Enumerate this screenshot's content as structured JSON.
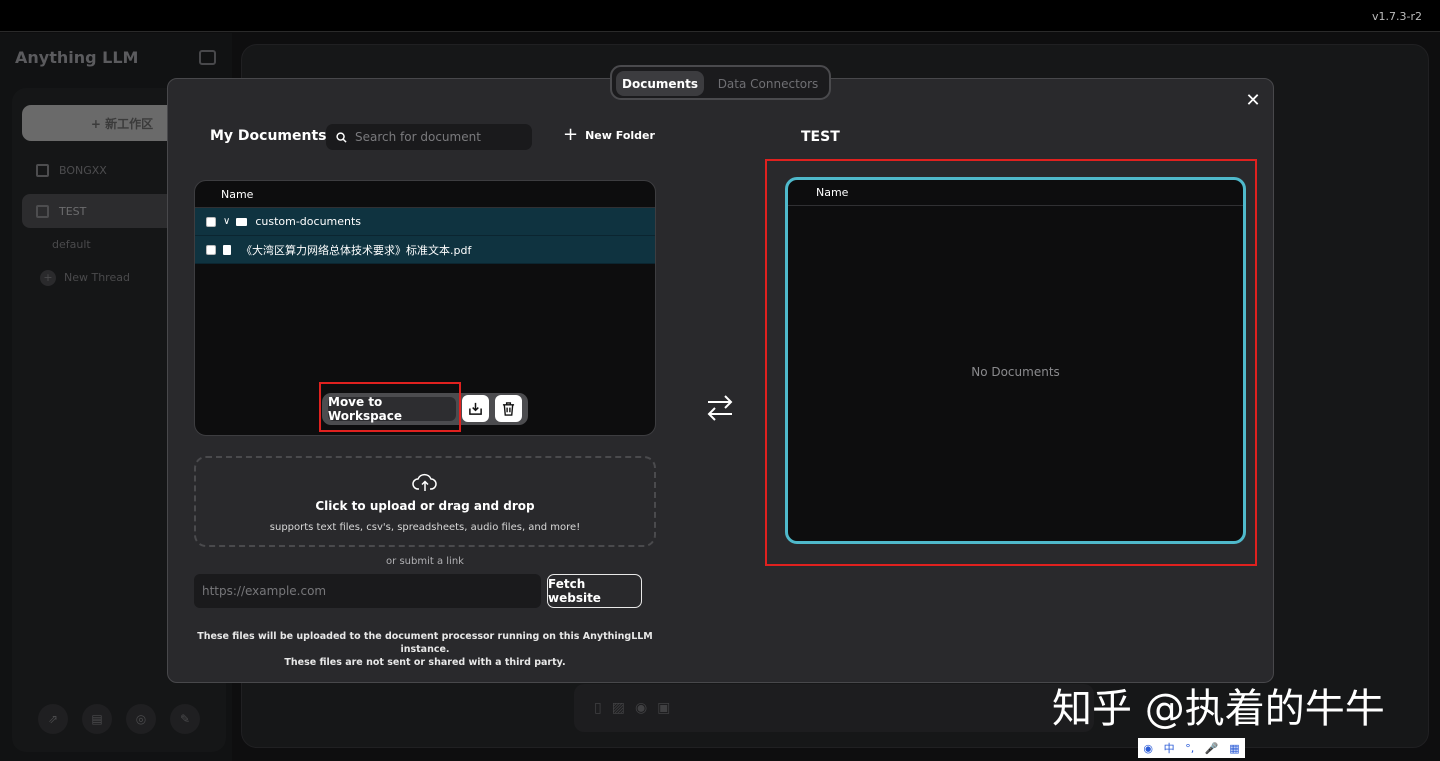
{
  "version": "v1.7.3-r2",
  "sidebar": {
    "logo": "Anything LLM",
    "new_workspace_label": "+ 新工作区",
    "workspaces": [
      {
        "label": "BONGXX"
      },
      {
        "label": "TEST"
      }
    ],
    "threads": [
      {
        "label": "default"
      },
      {
        "label": "New Thread"
      }
    ],
    "footer_icons": [
      "github-icon",
      "docs-icon",
      "discord-icon",
      "settings-icon"
    ]
  },
  "modal": {
    "tabs": [
      {
        "label": "Documents",
        "active": true
      },
      {
        "label": "Data Connectors",
        "active": false
      }
    ],
    "my_documents": {
      "title": "My Documents",
      "search_placeholder": "Search for document",
      "new_folder_label": "New Folder",
      "column_name": "Name",
      "rows": [
        {
          "type": "folder",
          "name": "custom-documents"
        },
        {
          "type": "file",
          "name": "《大湾区算力网络总体技术要求》标准文本.pdf"
        }
      ],
      "move_button": "Move to Workspace"
    },
    "upload": {
      "title": "Click to upload or drag and drop",
      "subtitle": "supports text files, csv's, spreadsheets, audio files, and more!",
      "or_link": "or submit a link",
      "url_placeholder": "https://example.com",
      "fetch_button": "Fetch website",
      "note_line1": "These files will be uploaded to the document processor running on this AnythingLLM instance.",
      "note_line2": "These files are not sent or shared with a third party."
    },
    "workspace": {
      "title": "TEST",
      "column_name": "Name",
      "empty_text": "No Documents"
    }
  },
  "watermark": "知乎 @执着的牛牛",
  "ime": {
    "items": [
      "中",
      "°,",
      "🎤",
      "▦"
    ]
  },
  "colors": {
    "accent_cyan": "#4fb9cb",
    "highlight_red": "#e0211f",
    "row_selected": "#0f3340"
  }
}
